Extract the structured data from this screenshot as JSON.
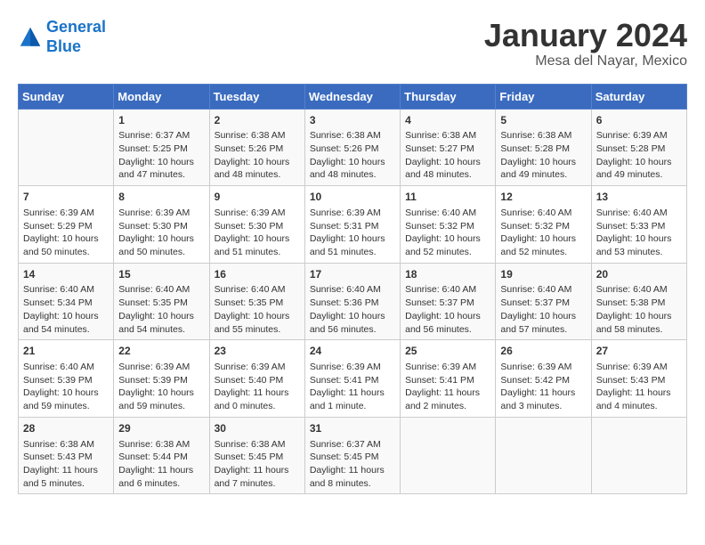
{
  "header": {
    "logo_line1": "General",
    "logo_line2": "Blue",
    "month_title": "January 2024",
    "location": "Mesa del Nayar, Mexico"
  },
  "columns": [
    "Sunday",
    "Monday",
    "Tuesday",
    "Wednesday",
    "Thursday",
    "Friday",
    "Saturday"
  ],
  "weeks": [
    [
      {
        "day": "",
        "content": ""
      },
      {
        "day": "1",
        "content": "Sunrise: 6:37 AM\nSunset: 5:25 PM\nDaylight: 10 hours\nand 47 minutes."
      },
      {
        "day": "2",
        "content": "Sunrise: 6:38 AM\nSunset: 5:26 PM\nDaylight: 10 hours\nand 48 minutes."
      },
      {
        "day": "3",
        "content": "Sunrise: 6:38 AM\nSunset: 5:26 PM\nDaylight: 10 hours\nand 48 minutes."
      },
      {
        "day": "4",
        "content": "Sunrise: 6:38 AM\nSunset: 5:27 PM\nDaylight: 10 hours\nand 48 minutes."
      },
      {
        "day": "5",
        "content": "Sunrise: 6:38 AM\nSunset: 5:28 PM\nDaylight: 10 hours\nand 49 minutes."
      },
      {
        "day": "6",
        "content": "Sunrise: 6:39 AM\nSunset: 5:28 PM\nDaylight: 10 hours\nand 49 minutes."
      }
    ],
    [
      {
        "day": "7",
        "content": "Sunrise: 6:39 AM\nSunset: 5:29 PM\nDaylight: 10 hours\nand 50 minutes."
      },
      {
        "day": "8",
        "content": "Sunrise: 6:39 AM\nSunset: 5:30 PM\nDaylight: 10 hours\nand 50 minutes."
      },
      {
        "day": "9",
        "content": "Sunrise: 6:39 AM\nSunset: 5:30 PM\nDaylight: 10 hours\nand 51 minutes."
      },
      {
        "day": "10",
        "content": "Sunrise: 6:39 AM\nSunset: 5:31 PM\nDaylight: 10 hours\nand 51 minutes."
      },
      {
        "day": "11",
        "content": "Sunrise: 6:40 AM\nSunset: 5:32 PM\nDaylight: 10 hours\nand 52 minutes."
      },
      {
        "day": "12",
        "content": "Sunrise: 6:40 AM\nSunset: 5:32 PM\nDaylight: 10 hours\nand 52 minutes."
      },
      {
        "day": "13",
        "content": "Sunrise: 6:40 AM\nSunset: 5:33 PM\nDaylight: 10 hours\nand 53 minutes."
      }
    ],
    [
      {
        "day": "14",
        "content": "Sunrise: 6:40 AM\nSunset: 5:34 PM\nDaylight: 10 hours\nand 54 minutes."
      },
      {
        "day": "15",
        "content": "Sunrise: 6:40 AM\nSunset: 5:35 PM\nDaylight: 10 hours\nand 54 minutes."
      },
      {
        "day": "16",
        "content": "Sunrise: 6:40 AM\nSunset: 5:35 PM\nDaylight: 10 hours\nand 55 minutes."
      },
      {
        "day": "17",
        "content": "Sunrise: 6:40 AM\nSunset: 5:36 PM\nDaylight: 10 hours\nand 56 minutes."
      },
      {
        "day": "18",
        "content": "Sunrise: 6:40 AM\nSunset: 5:37 PM\nDaylight: 10 hours\nand 56 minutes."
      },
      {
        "day": "19",
        "content": "Sunrise: 6:40 AM\nSunset: 5:37 PM\nDaylight: 10 hours\nand 57 minutes."
      },
      {
        "day": "20",
        "content": "Sunrise: 6:40 AM\nSunset: 5:38 PM\nDaylight: 10 hours\nand 58 minutes."
      }
    ],
    [
      {
        "day": "21",
        "content": "Sunrise: 6:40 AM\nSunset: 5:39 PM\nDaylight: 10 hours\nand 59 minutes."
      },
      {
        "day": "22",
        "content": "Sunrise: 6:39 AM\nSunset: 5:39 PM\nDaylight: 10 hours\nand 59 minutes."
      },
      {
        "day": "23",
        "content": "Sunrise: 6:39 AM\nSunset: 5:40 PM\nDaylight: 11 hours\nand 0 minutes."
      },
      {
        "day": "24",
        "content": "Sunrise: 6:39 AM\nSunset: 5:41 PM\nDaylight: 11 hours\nand 1 minute."
      },
      {
        "day": "25",
        "content": "Sunrise: 6:39 AM\nSunset: 5:41 PM\nDaylight: 11 hours\nand 2 minutes."
      },
      {
        "day": "26",
        "content": "Sunrise: 6:39 AM\nSunset: 5:42 PM\nDaylight: 11 hours\nand 3 minutes."
      },
      {
        "day": "27",
        "content": "Sunrise: 6:39 AM\nSunset: 5:43 PM\nDaylight: 11 hours\nand 4 minutes."
      }
    ],
    [
      {
        "day": "28",
        "content": "Sunrise: 6:38 AM\nSunset: 5:43 PM\nDaylight: 11 hours\nand 5 minutes."
      },
      {
        "day": "29",
        "content": "Sunrise: 6:38 AM\nSunset: 5:44 PM\nDaylight: 11 hours\nand 6 minutes."
      },
      {
        "day": "30",
        "content": "Sunrise: 6:38 AM\nSunset: 5:45 PM\nDaylight: 11 hours\nand 7 minutes."
      },
      {
        "day": "31",
        "content": "Sunrise: 6:37 AM\nSunset: 5:45 PM\nDaylight: 11 hours\nand 8 minutes."
      },
      {
        "day": "",
        "content": ""
      },
      {
        "day": "",
        "content": ""
      },
      {
        "day": "",
        "content": ""
      }
    ]
  ]
}
